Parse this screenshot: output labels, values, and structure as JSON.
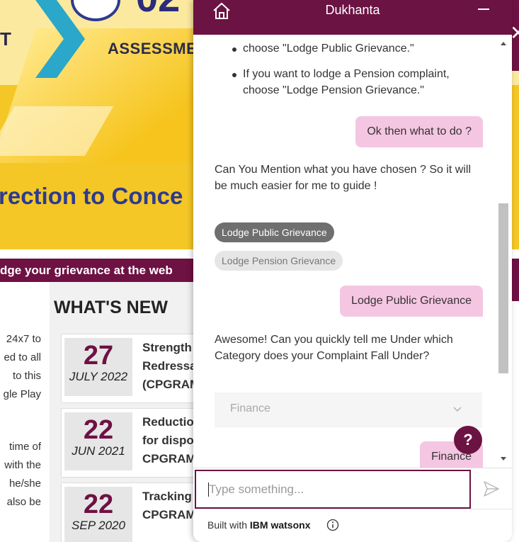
{
  "background_page": {
    "banner": {
      "fragment_left": "T",
      "fragment_assessment": "ASSESSME",
      "fragment_number": "02",
      "fragment_headline": "rection to Conce"
    },
    "ticker_text": "dge your grievance at the web",
    "left_text_lines": [
      "24x7 to",
      "ed to all",
      "to this",
      "gle Play",
      "",
      "time of",
      "with the",
      "he/she",
      "also be"
    ],
    "whats_new_title": "WHAT'S NEW",
    "news": [
      {
        "day": "27",
        "month": "JULY 2022",
        "lines": [
          "Strength",
          "Redressa",
          "(CPGRAM"
        ]
      },
      {
        "day": "22",
        "month": "JUN 2021",
        "lines": [
          "Reduction",
          "for dispo",
          "CPGRAM"
        ]
      },
      {
        "day": "22",
        "month": "SEP 2020",
        "lines": [
          "Tracking",
          "CPGRAM"
        ]
      }
    ]
  },
  "chat": {
    "title": "Dukhanta",
    "bullet_cut": "choose \"Lodge Public Grievance.\"",
    "bullet_full": "If you want to lodge a Pension complaint, choose \"Lodge Pension Grievance.\"",
    "user_msg_1": "Ok then what to do ?",
    "bot_msg_1": "Can You Mention what you have chosen ? So it will be much easier for me to guide !",
    "options": [
      {
        "label": "Lodge Public Grievance",
        "selected": true
      },
      {
        "label": "Lodge Pension Grievance",
        "selected": false
      }
    ],
    "user_msg_2": "Lodge Public Grievance",
    "bot_msg_2": "Awesome! Can you quickly tell me Under which Category does your Complaint Fall Under?",
    "dropdown_value": "Finance",
    "user_msg_3": "Finance",
    "help_label": "?",
    "input_placeholder": "Type something...",
    "footer_prefix": "Built with ",
    "footer_brand": "IBM watsonx"
  },
  "colors": {
    "brand": "#6b1343",
    "user_bubble": "#f5c6e2",
    "selected_option": "#6f6f6f",
    "banner_yellow": "#f4c726"
  },
  "icons": {
    "home": "home-icon",
    "minimize": "minimize-icon",
    "send": "send-icon",
    "info": "info-icon",
    "help": "help-icon",
    "chevron": "chevron-down-icon"
  }
}
